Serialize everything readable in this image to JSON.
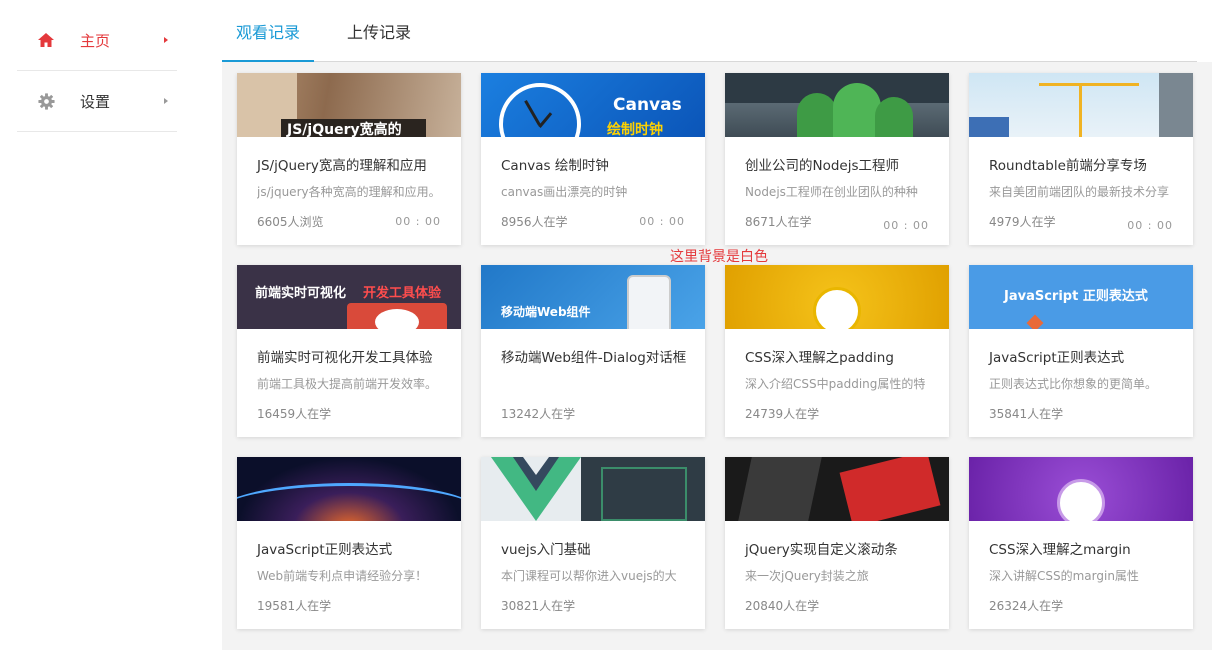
{
  "sidebar": {
    "items": [
      {
        "label": "主页",
        "icon": "home-icon",
        "active": true
      },
      {
        "label": "设置",
        "icon": "gear-icon",
        "active": false
      }
    ]
  },
  "tabs": [
    {
      "label": "观看记录",
      "active": true
    },
    {
      "label": "上传记录",
      "active": false
    }
  ],
  "note": "这里背景是白色",
  "colors": {
    "accent": "#1a9ad6",
    "active_red": "#e4393c",
    "panel_bg": "#f3f3f3"
  },
  "cards": [
    {
      "title": "JS/jQuery宽高的理解和应用",
      "desc": "js/jquery各种宽高的理解和应用。",
      "count": "6605人浏览",
      "time": "00 : 00",
      "thumb_text": "JS/jQuery宽高的"
    },
    {
      "title": "Canvas 绘制时钟",
      "desc": "canvas画出漂亮的时钟",
      "count": "8956人在学",
      "time": "00 : 00",
      "thumb_text": "Canvas",
      "thumb_text2": "绘制时钟"
    },
    {
      "title": "创业公司的Nodejs工程师",
      "desc": "Nodejs工程师在创业团队的种种",
      "count": "8671人在学",
      "time": "00 : 00"
    },
    {
      "title": "Roundtable前端分享专场",
      "desc": "来自美团前端团队的最新技术分享",
      "count": "4979人在学",
      "time": "00 : 00"
    },
    {
      "title": "前端实时可视化开发工具体验",
      "desc": "前端工具极大提高前端开发效率。",
      "count": "16459人在学",
      "thumb_text": "前端实时可视化",
      "thumb_text2": "开发工具体验"
    },
    {
      "title": "移动端Web组件-Dialog对话框",
      "desc": "",
      "count": "13242人在学",
      "thumb_text": "移动端Web组件"
    },
    {
      "title": "CSS深入理解之padding",
      "desc": "深入介绍CSS中padding属性的特",
      "count": "24739人在学"
    },
    {
      "title": "JavaScript正则表达式",
      "desc": "正则表达式比你想象的更简单。",
      "count": "35841人在学",
      "thumb_text": "JavaScript 正则表达式"
    },
    {
      "title": "JavaScript正则表达式",
      "desc": "Web前端专利点申请经验分享！",
      "count": "19581人在学"
    },
    {
      "title": "vuejs入门基础",
      "desc": "本门课程可以帮你进入vuejs的大",
      "count": "30821人在学"
    },
    {
      "title": "jQuery实现自定义滚动条",
      "desc": "来一次jQuery封装之旅",
      "count": "20840人在学"
    },
    {
      "title": "CSS深入理解之margin",
      "desc": "深入讲解CSS的margin属性",
      "count": "26324人在学"
    }
  ]
}
